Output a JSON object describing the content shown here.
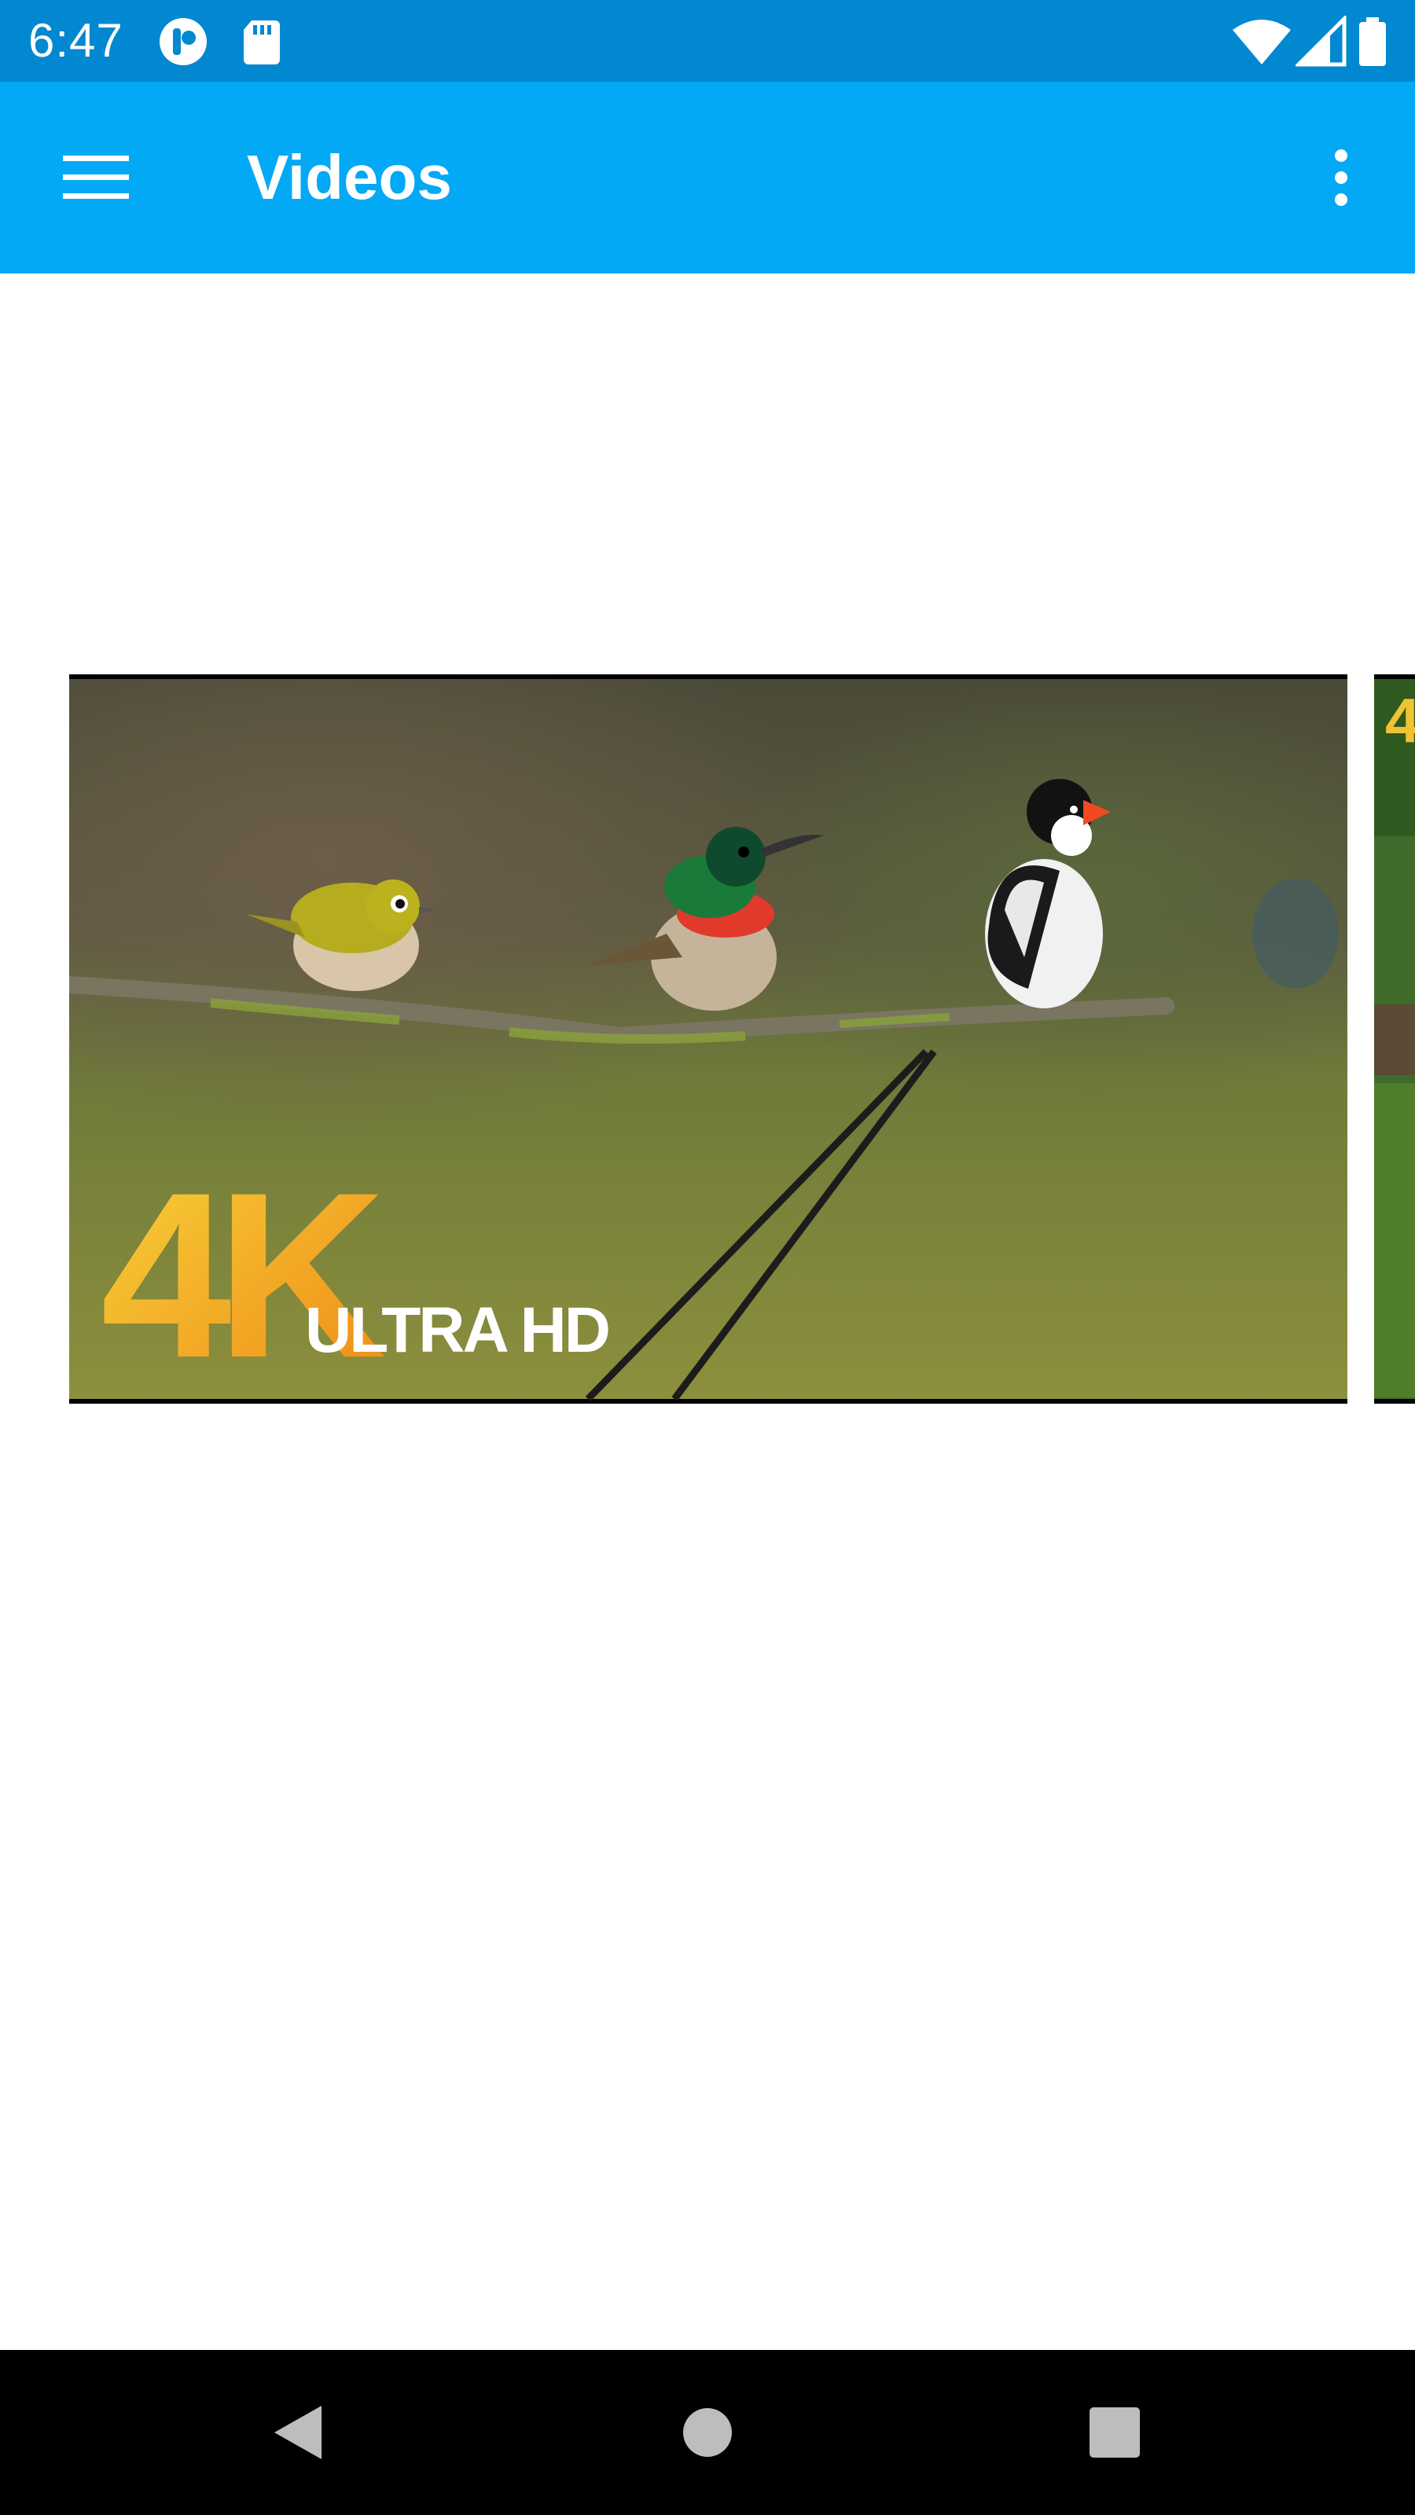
{
  "status_bar": {
    "time": "6:47",
    "left_icons": [
      "notification-app-icon",
      "sd-card-icon"
    ],
    "right_icons": [
      "wifi-icon",
      "cell-signal-icon",
      "battery-icon"
    ]
  },
  "app_bar": {
    "title": "Videos",
    "menu_icon": "hamburger-menu-icon",
    "overflow_icon": "more-vert-icon"
  },
  "video_carousel": {
    "items": [
      {
        "badge_main": "4K",
        "badge_sub": "ULTRA HD"
      },
      {
        "badge_main": "4"
      }
    ]
  },
  "nav_bar": {
    "buttons": [
      "back-icon",
      "home-icon",
      "recents-icon"
    ]
  },
  "colors": {
    "status_bar": "#0288d1",
    "app_bar": "#03a9f4",
    "background": "#ffffff",
    "nav_bar": "#000000",
    "badge_gold": "#f4b81c",
    "badge_orange": "#f0901a"
  }
}
